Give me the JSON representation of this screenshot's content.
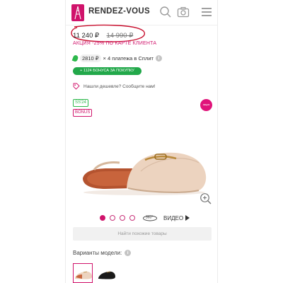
{
  "header": {
    "brand": "RENDEZ-VOUS",
    "icons": [
      "logo-icon",
      "search-icon",
      "camera-icon",
      "menu-icon"
    ]
  },
  "price": {
    "current": "11 240 ₽",
    "old": "14 990 ₽"
  },
  "promo": {
    "text": "АКЦИЯ -25% ПО КАРТЕ КЛИЕНТА"
  },
  "split": {
    "amount": "2810 ₽",
    "text": "× 4 платежа в Сплит",
    "info": "i"
  },
  "bonus": {
    "label": "+ 1124 БОНУСА ЗА ПОКУПКУ"
  },
  "cheaper": {
    "text": "Нашли дешевле? Сообщите нам!"
  },
  "badges": {
    "season": "SS'24",
    "bonus": "BONUS"
  },
  "sale_badge": {
    "text": "акция"
  },
  "gallery": {
    "dots": 4,
    "active_index": 0,
    "rotation": "360°",
    "video": "ВИДЕО"
  },
  "similar": {
    "label": "Найти похожие товары"
  },
  "variants": {
    "label": "Варианты модели:",
    "info": "i"
  },
  "colors": {
    "brand": "#d0136b",
    "green": "#22a84a",
    "product": "#ecd3bf"
  }
}
